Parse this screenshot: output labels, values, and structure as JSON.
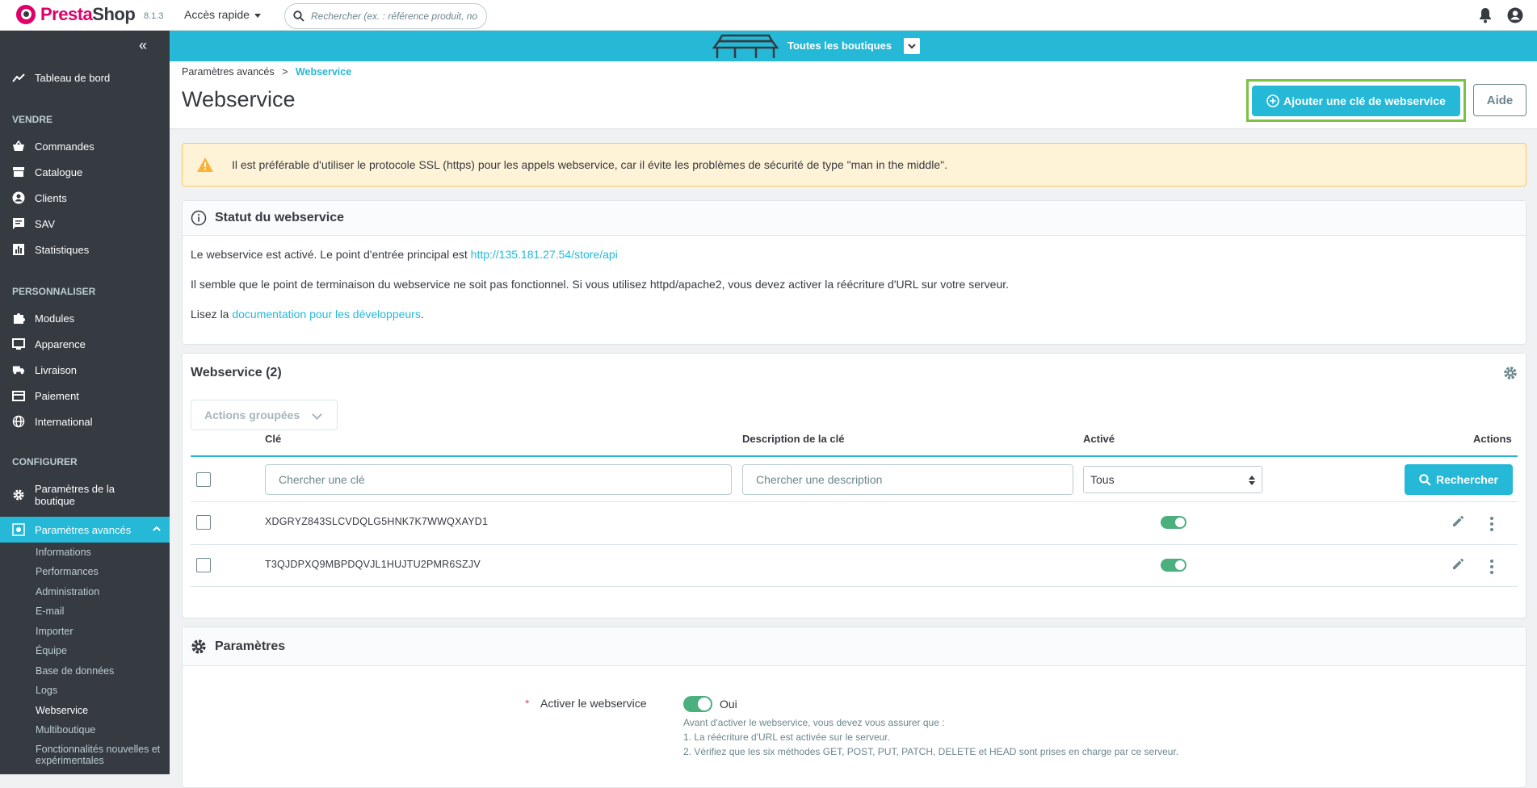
{
  "app": {
    "name_pre": "Presta",
    "name_brand": "Shop",
    "version": "8.1.3"
  },
  "topbar": {
    "quick_access": "Accès rapide",
    "search_placeholder": "Rechercher (ex. : référence produit, no"
  },
  "shopbar": {
    "label": "Toutes les boutiques"
  },
  "sidebar": {
    "dashboard": "Tableau de bord",
    "sections": {
      "sell": "VENDRE",
      "customize": "PERSONNALISER",
      "configure": "CONFIGURER"
    },
    "sell_items": [
      "Commandes",
      "Catalogue",
      "Clients",
      "SAV",
      "Statistiques"
    ],
    "customize_items": [
      "Modules",
      "Apparence",
      "Livraison",
      "Paiement",
      "International"
    ],
    "configure_items": [
      "Paramètres de la boutique",
      "Paramètres avancés"
    ],
    "sub_items": [
      "Informations",
      "Performances",
      "Administration",
      "E-mail",
      "Importer",
      "Équipe",
      "Base de données",
      "Logs",
      "Webservice",
      "Multiboutique",
      "Fonctionnalités nouvelles et expérimentales"
    ]
  },
  "header": {
    "breadcrumb_parent": "Paramètres avancés",
    "breadcrumb_sep": ">",
    "breadcrumb_current": "Webservice",
    "title": "Webservice",
    "add_button": "Ajouter une clé de webservice",
    "help_button": "Aide"
  },
  "alert": {
    "text": "Il est préférable d'utiliser le protocole SSL (https) pour les appels webservice, car il évite les problèmes de sécurité de type \"man in the middle\"."
  },
  "status": {
    "title": "Statut du webservice",
    "line1": "Le webservice est activé. Le point d'entrée principal est",
    "endpoint": "http://135.181.27.54/store/api",
    "line2": "Il semble que le point de terminaison du webservice ne soit pas fonctionnel. Si vous utilisez httpd/apache2, vous devez activer la réécriture d'URL sur votre serveur.",
    "line3_pre": "Lisez la",
    "doc_link": "documentation pour les développeurs",
    "line3_post": "."
  },
  "list": {
    "title": "Webservice (2)",
    "bulk": "Actions groupées",
    "columns": {
      "key": "Clé",
      "desc": "Description de la clé",
      "active": "Activé",
      "actions": "Actions"
    },
    "filters": {
      "key_placeholder": "Chercher une clé",
      "desc_placeholder": "Chercher une description",
      "active_value": "Tous",
      "search_button": "Rechercher"
    },
    "rows": [
      {
        "key": "XDGRYZ843SLCVDQLG5HNK7K7WWQXAYD1",
        "active": true
      },
      {
        "key": "T3QJDPXQ9MBPDQVJL1HUJTU2PMR6SZJV",
        "active": true
      }
    ]
  },
  "params": {
    "title": "Paramètres",
    "required_mark": "*",
    "enable_label": "Activer le webservice",
    "enable_value": "Oui",
    "help_1": "Avant d'activer le webservice, vous devez vous assurer que :",
    "help_2": "1. La réécriture d'URL est activée sur le serveur.",
    "help_3": "2. Vérifiez que les six méthodes GET, POST, PUT, PATCH, DELETE et HEAD sont prises en charge par ce serveur."
  },
  "colors": {
    "accent": "#25b9d7",
    "sidebar": "#363a41",
    "brand": "#df0067",
    "highlight": "#7cc242",
    "toggle_on": "#4caf7e"
  }
}
